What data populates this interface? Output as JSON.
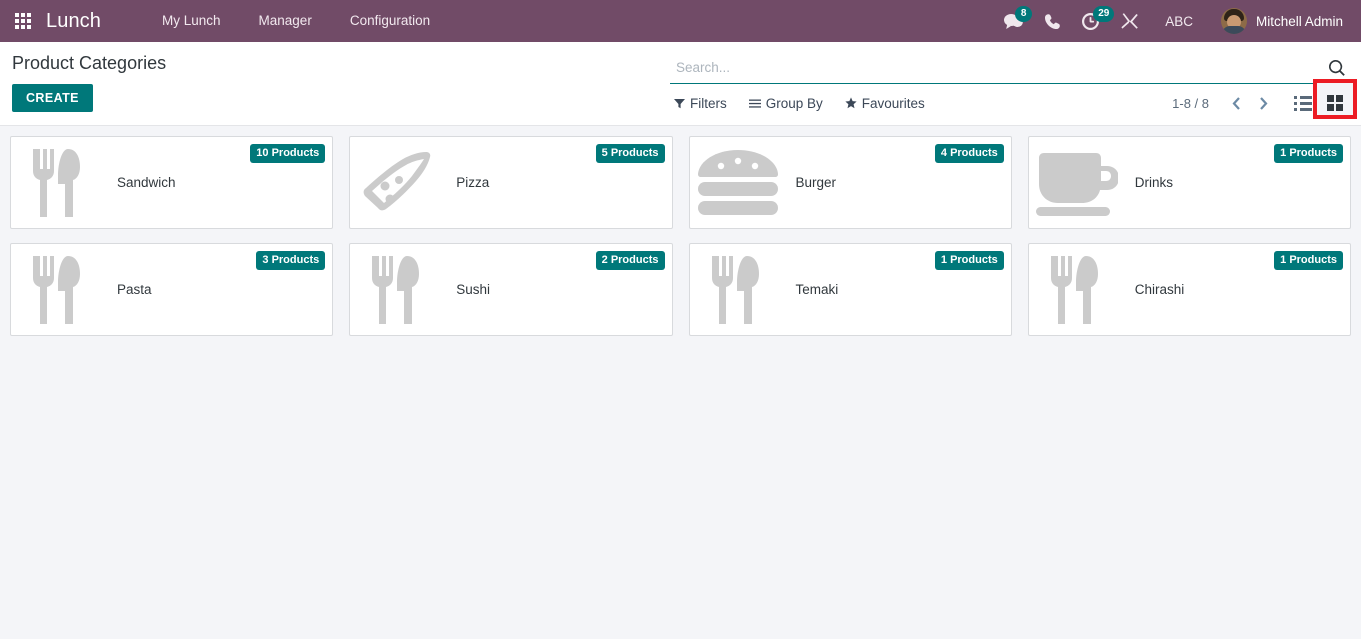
{
  "navbar": {
    "apps_icon": "apps-grid-icon",
    "brand": "Lunch",
    "menu": [
      {
        "label": "My Lunch"
      },
      {
        "label": "Manager"
      },
      {
        "label": "Configuration"
      }
    ],
    "systray": {
      "messages_icon": "messages-icon",
      "messages_count": "8",
      "voip_icon": "phone-icon",
      "activities_icon": "activities-clock-icon",
      "activities_count": "29",
      "debug_icon": "debug-tools-icon",
      "language": "ABC"
    },
    "user": {
      "avatar_icon": "user-avatar",
      "name": "Mitchell Admin"
    },
    "colors": {
      "navbar_bg": "#714B67",
      "badge_bg": "#00787a"
    }
  },
  "control_panel": {
    "page_title": "Product Categories",
    "create_label": "CREATE",
    "search": {
      "placeholder": "Search...",
      "value": "",
      "icon": "search-icon"
    },
    "filter_buttons": [
      {
        "label": "Filters",
        "icon": "filter-funnel-icon"
      },
      {
        "label": "Group By",
        "icon": "group-by-lines-icon"
      },
      {
        "label": "Favourites",
        "icon": "favourites-star-icon"
      }
    ],
    "pager": {
      "range": "1-8 / 8",
      "previous_icon": "chevron-left-icon",
      "next_icon": "chevron-right-icon"
    },
    "views": [
      {
        "name": "list",
        "icon": "list-view-icon",
        "active": false
      },
      {
        "name": "kanban",
        "icon": "kanban-view-icon",
        "active": true
      }
    ],
    "highlight": {
      "target": "kanban-view-icon",
      "color": "#ec1c24"
    }
  },
  "kanban": {
    "cards": [
      {
        "name": "Sandwich",
        "badge": "10 Products",
        "image": "cutlery-placeholder-icon"
      },
      {
        "name": "Pizza",
        "badge": "5 Products",
        "image": "pizza-slice-icon"
      },
      {
        "name": "Burger",
        "badge": "4 Products",
        "image": "burger-icon"
      },
      {
        "name": "Drinks",
        "badge": "1 Products",
        "image": "coffee-cup-icon"
      },
      {
        "name": "Pasta",
        "badge": "3 Products",
        "image": "cutlery-placeholder-icon"
      },
      {
        "name": "Sushi",
        "badge": "2 Products",
        "image": "cutlery-placeholder-icon"
      },
      {
        "name": "Temaki",
        "badge": "1 Products",
        "image": "cutlery-placeholder-icon"
      },
      {
        "name": "Chirashi",
        "badge": "1 Products",
        "image": "cutlery-placeholder-icon"
      }
    ]
  }
}
